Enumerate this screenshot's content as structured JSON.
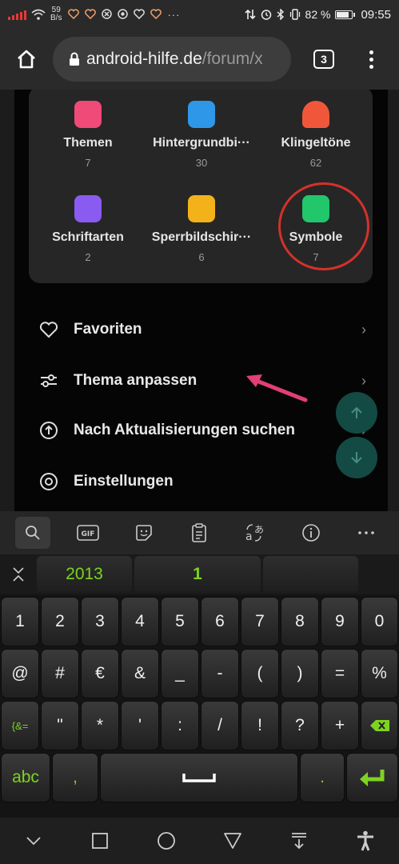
{
  "status_bar": {
    "net_speed_value": "59",
    "net_speed_unit": "B/s",
    "battery_percent": "82 %",
    "battery_level": 0.82,
    "time": "09:55",
    "icons": [
      "signal-icon",
      "wifi-icon",
      "health-icon",
      "health-icon",
      "block-icon",
      "chrome-icon",
      "health-icon",
      "health-icon",
      "more-icon",
      "data-arrows-icon",
      "alarm-icon",
      "bluetooth-icon",
      "vibrate-icon",
      "battery-icon"
    ]
  },
  "browser": {
    "url_host": "android-hilfe.de",
    "url_path": "/forum/x",
    "tab_count": "3"
  },
  "app_content": {
    "grid": [
      {
        "label": "Themen",
        "count": "7",
        "color": "#ef4a78"
      },
      {
        "label": "Hintergrundbi···",
        "count": "30",
        "color": "#2f97e8"
      },
      {
        "label": "Klingeltöne",
        "count": "62",
        "color": "#f0573a"
      },
      {
        "label": "Schriftarten",
        "count": "2",
        "color": "#8a5bf0"
      },
      {
        "label": "Sperrbildschir···",
        "count": "6",
        "color": "#f4b21a"
      },
      {
        "label": "Symbole",
        "count": "7",
        "color": "#22c66b"
      }
    ],
    "menu": [
      {
        "label": "Favoriten",
        "icon": "heart-icon"
      },
      {
        "label": "Thema anpassen",
        "icon": "sliders-icon"
      },
      {
        "label": "Nach Aktualisierungen suchen",
        "icon": "upload-icon"
      },
      {
        "label": "Einstellungen",
        "icon": "settings-icon"
      }
    ]
  },
  "keyboard": {
    "toolbar": [
      "search-icon",
      "gif-icon",
      "sticker-icon",
      "clipboard-icon",
      "translate-icon",
      "info-icon",
      "more-icon"
    ],
    "suggestions": [
      "2013",
      "1",
      ""
    ],
    "row1": [
      "1",
      "2",
      "3",
      "4",
      "5",
      "6",
      "7",
      "8",
      "9",
      "0"
    ],
    "row2": [
      "@",
      "#",
      "€",
      "&",
      "_",
      "-",
      "(",
      ")",
      "=",
      "%"
    ],
    "row3": [
      "{&=",
      "\"",
      "*",
      "'",
      ":",
      "/",
      "!",
      "?",
      "+"
    ],
    "row4": [
      "abc",
      ",",
      ""
    ],
    "row4_period": ".",
    "accent": "#7ed321"
  },
  "navbar": [
    "collapse-icon",
    "square-icon",
    "circle-icon",
    "back-icon",
    "download-icon",
    "accessibility-icon"
  ]
}
